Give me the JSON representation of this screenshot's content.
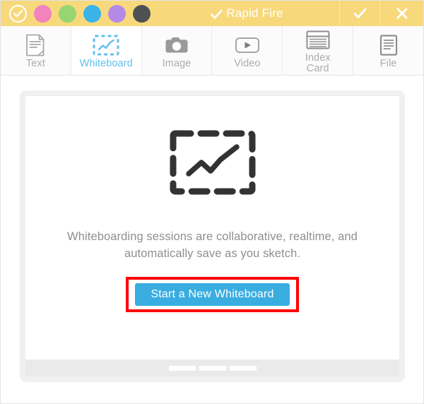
{
  "window": {
    "title": "Rapid Fire",
    "title_check_icon": "check-icon",
    "accent_header_color": "#f7d97c",
    "accent_blue": "#39ade0",
    "highlight_color": "#ff0000"
  },
  "titlebar": {
    "status_dot": {
      "icon": "check-circle-icon",
      "color": "#ffffff"
    },
    "dots": [
      {
        "name": "color-dot-pink",
        "color": "#f283bd"
      },
      {
        "name": "color-dot-green",
        "color": "#96d572"
      },
      {
        "name": "color-dot-blue",
        "color": "#39b3e8"
      },
      {
        "name": "color-dot-purple",
        "color": "#b489e8"
      },
      {
        "name": "color-dot-gray",
        "color": "#4f5052"
      }
    ],
    "confirm_icon": "check-icon",
    "close_icon": "close-icon"
  },
  "tabs": [
    {
      "label": "Text",
      "icon": "document-text-icon",
      "active": false
    },
    {
      "label": "Whiteboard",
      "icon": "whiteboard-chart-icon",
      "active": true
    },
    {
      "label": "Image",
      "icon": "camera-icon",
      "active": false
    },
    {
      "label": "Video",
      "icon": "video-play-icon",
      "active": false
    },
    {
      "label": "Index",
      "label2": "Card",
      "icon": "index-card-icon",
      "active": false
    },
    {
      "label": "File",
      "icon": "file-lines-icon",
      "active": false
    }
  ],
  "panel": {
    "illustration_icon": "dashed-chart-icon",
    "description_line1": "Whiteboarding sessions are collaborative, realtime, and",
    "description_line2": "automatically save as you sketch.",
    "cta_label": "Start a New Whiteboard",
    "footer_bars": 3
  }
}
